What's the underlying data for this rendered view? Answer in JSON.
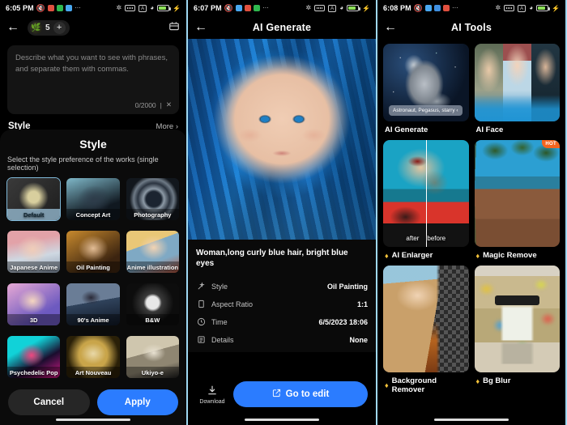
{
  "panels": {
    "generate": {
      "status": {
        "time": "6:05 PM",
        "dnd_icon": "mute-icon",
        "overflow": "···"
      },
      "appbar": {
        "back": "←",
        "credits": "5",
        "add": "+",
        "gallery_icon": "gallery-icon"
      },
      "prompt": {
        "placeholder": "Describe what you want to see with phrases, and separate them with commas.",
        "counter": "0/2000",
        "clear": "✕",
        "divider": "|"
      },
      "section": {
        "title": "Style",
        "more": "More"
      },
      "sheet": {
        "title": "Style",
        "subtitle": "Select the style preference of the works (single selection)",
        "cancel": "Cancel",
        "apply": "Apply",
        "styles": [
          {
            "label": "Default",
            "selected": true
          },
          {
            "label": "Concept Art",
            "selected": false
          },
          {
            "label": "Photography",
            "selected": false
          },
          {
            "label": "Japanese Anime",
            "selected": false
          },
          {
            "label": "Oil Painting",
            "selected": false
          },
          {
            "label": "Anime illustration",
            "selected": false
          },
          {
            "label": "3D",
            "selected": false
          },
          {
            "label": "90's Anime",
            "selected": false
          },
          {
            "label": "B&W",
            "selected": false
          },
          {
            "label": "Psychedelic Pop",
            "selected": false
          },
          {
            "label": "Art Nouveau",
            "selected": false
          },
          {
            "label": "Ukiyo-e",
            "selected": false
          }
        ]
      }
    },
    "result": {
      "status": {
        "time": "6:07 PM",
        "overflow": "···"
      },
      "appbar": {
        "back": "←",
        "title": "AI Generate"
      },
      "prompt_text": "Woman,long curly blue hair, bright blue eyes",
      "info": [
        {
          "icon": "magic-wand-icon",
          "label": "Style",
          "value": "Oil Painting"
        },
        {
          "icon": "aspect-ratio-icon",
          "label": "Aspect Ratio",
          "value": "1:1"
        },
        {
          "icon": "clock-icon",
          "label": "Time",
          "value": "6/5/2023 18:06"
        },
        {
          "icon": "details-icon",
          "label": "Details",
          "value": "None"
        }
      ],
      "download": {
        "icon": "download-icon",
        "label": "Download"
      },
      "primary": {
        "icon": "edit-icon",
        "label": "Go to edit"
      }
    },
    "tools": {
      "status": {
        "time": "6:08 PM",
        "overflow": "···"
      },
      "appbar": {
        "back": "←",
        "title": "AI Tools"
      },
      "cards": [
        {
          "label": "AI Generate",
          "pro": false,
          "hot": false,
          "chip": "Astronaut, Pegasus, starry ‹"
        },
        {
          "label": "AI Face",
          "pro": false,
          "hot": false
        },
        {
          "label": "AI Enlarger",
          "pro": true,
          "hot": false,
          "after": "after",
          "before": "before"
        },
        {
          "label": "Magic Remove",
          "pro": true,
          "hot": true,
          "hot_label": "HOT"
        },
        {
          "label": "Background Remover",
          "pro": true,
          "hot": false
        },
        {
          "label": "Bg Blur",
          "pro": true,
          "hot": false
        }
      ]
    }
  },
  "colors": {
    "accent": "#2b7cff",
    "frame": "#9fd8f2",
    "hot": "#f4651f",
    "crown": "#f5c33b",
    "battery": "#8ee05a"
  }
}
